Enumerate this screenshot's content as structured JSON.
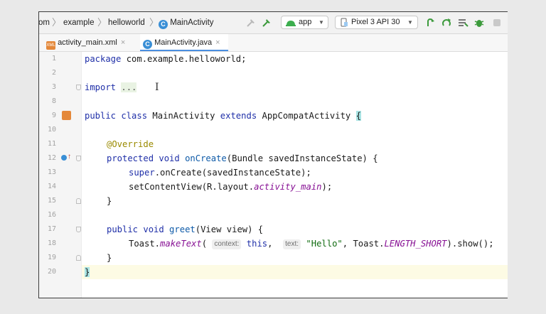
{
  "toolbar": {
    "breadcrumb": [
      "om",
      "example",
      "helloworld",
      "MainActivity"
    ],
    "class_badge": "C",
    "run_config": "app",
    "device": "Pixel 3 API 30"
  },
  "tabs": [
    {
      "label": "activity_main.xml",
      "close": "×",
      "active": false
    },
    {
      "label": "MainActivity.java",
      "close": "×",
      "active": true
    }
  ],
  "editor": {
    "line_numbers": [
      "1",
      "2",
      "3",
      "8",
      "9",
      "10",
      "11",
      "12",
      "13",
      "14",
      "15",
      "16",
      "17",
      "18",
      "19",
      "20"
    ],
    "cursor_glyph": "I",
    "code": {
      "l1_kw": "package",
      "l1_rest": " com.example.helloworld;",
      "l3_kw": "import",
      "l3_fold": "...",
      "l9_kw": "public class",
      "l9_name": " MainActivity ",
      "l9_kw2": "extends",
      "l9_parent": " AppCompatActivity ",
      "l9_brace": "{",
      "l11_ann": "@Override",
      "l12_kw": "protected void",
      "l12_fn": " onCreate",
      "l12_rest": "(Bundle savedInstanceState) {",
      "l13_kw": "super",
      "l13_rest": ".onCreate(savedInstanceState);",
      "l14_pre": "setContentView(R.layout.",
      "l14_it": "activity_main",
      "l14_post": ");",
      "l15": "}",
      "l17_kw": "public void",
      "l17_fn": " greet",
      "l17_rest": "(View view) {",
      "l18_pre": "Toast.",
      "l18_it": "makeText",
      "l18_paren": "( ",
      "l18_hint1": "context:",
      "l18_this": " this",
      "l18_comma": ",  ",
      "l18_hint2": "text:",
      "l18_str": " \"Hello\"",
      "l18_mid": ", Toast.",
      "l18_const": "LENGTH_SHORT",
      "l18_end": ").show();",
      "l19": "}",
      "l20": "}"
    }
  },
  "colors": {
    "keyword": "#1f2fa8",
    "annotation": "#9a8a00",
    "string": "#106b10",
    "italic_ref": "#871094",
    "accent": "#4a8ee0"
  }
}
